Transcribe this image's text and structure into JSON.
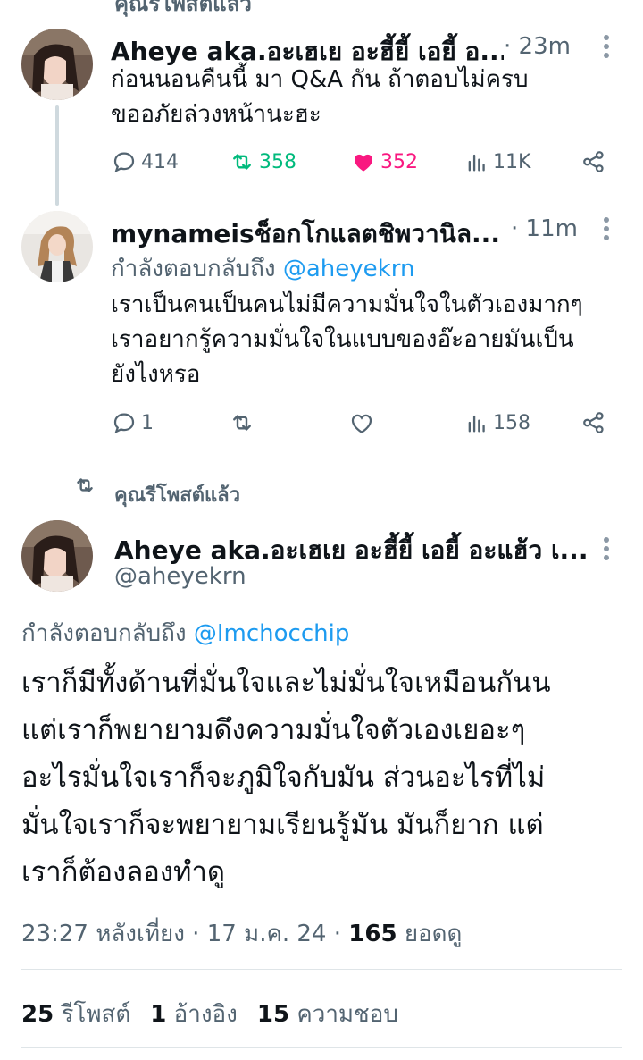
{
  "top_banner_partial": "คุณรีโพสต์แล้ว",
  "tweet1": {
    "name": "Aheye aka.อะเฮเย อะฮี้ยี้ เอยี้ อ...",
    "time": "· 23m",
    "text_lines": [
      "ก่อนนอนคืนนี้ มา Q&A กัน ถ้าตอบไม่ครบ",
      "ขออภัยล่วงหน้านะฮะ"
    ],
    "replies": "414",
    "reposts": "358",
    "likes": "352",
    "views": "11K",
    "colors": {
      "repost": "#00ba7c",
      "like": "#f91880"
    }
  },
  "tweet2": {
    "name": "mynameisช็อกโกแลตชิพวานิล...",
    "time": "· 11m",
    "replying_prefix": "กำลังตอบกลับถึง",
    "replying_handle": "@aheyekrn",
    "text_lines": [
      "เราเป็นคนเป็นคนไม่มีความมั่นใจในตัวเองมากๆ",
      "เราอยากรู้ความมั่นใจในแบบของอ๊ะอายมันเป็น",
      "ยังไงหรอ"
    ],
    "replies": "1",
    "views": "158"
  },
  "repost_banner": "คุณรีโพสต์แล้ว",
  "main_tweet": {
    "name": "Aheye aka.อะเฮเย อะฮี้ยี้ เอยี้ อะแฮ้ว เ...",
    "handle": "@aheyekrn",
    "replying_prefix": "กำลังตอบกลับถึง",
    "replying_handle": "@Imchocchip",
    "text_lines": [
      "เราก็มีทั้งด้านที่มั่นใจและไม่มั่นใจเหมือนกันน",
      "แต่เราก็พยายามดึงความมั่นใจตัวเองเยอะๆ",
      "อะไรมั่นใจเราก็จะภูมิใจกับมัน ส่วนอะไรที่ไม่",
      "มั่นใจเราก็จะพยายามเรียนรู้มัน มันก็ยาก แต่",
      "เราก็ต้องลองทำดู"
    ],
    "timestamp": "23:27 หลังเที่ยง · 17 ม.ค. 24 ·",
    "views_count": "165",
    "views_label": "ยอดดู",
    "stats": {
      "reposts_count": "25",
      "reposts_label": "รีโพสต์",
      "quotes_count": "1",
      "quotes_label": "อ้างอิง",
      "likes_count": "15",
      "likes_label": "ความชอบ"
    }
  }
}
